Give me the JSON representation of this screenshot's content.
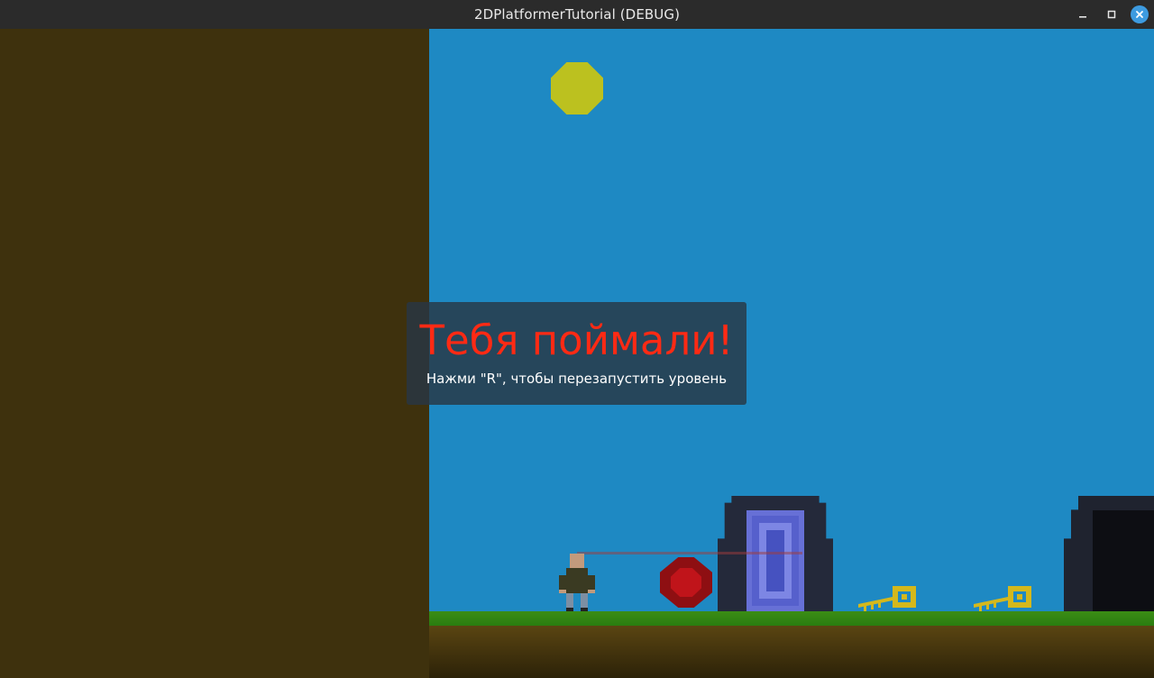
{
  "window": {
    "title": "2DPlatformerTutorial (DEBUG)",
    "controls": {
      "minimize_icon": "minimize-icon",
      "maximize_icon": "maximize-icon",
      "close_icon": "close-icon"
    }
  },
  "game": {
    "overlay": {
      "title": "Тебя поймали!",
      "subtitle": "Нажми \"R\", чтобы перезапустить уровень"
    },
    "colors": {
      "sky": "#1e89c3",
      "wall": "#3e310d",
      "sun": "#bcc11f",
      "grass": "#3b8d15",
      "overlay_title": "#ff2a14",
      "portal": "#7d86e4",
      "enemy": "#c0141a",
      "key": "#d4b81c"
    }
  }
}
